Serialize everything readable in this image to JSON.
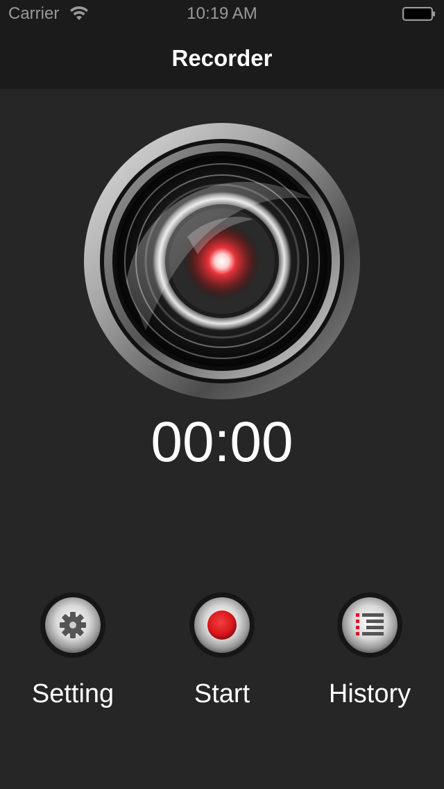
{
  "status_bar": {
    "carrier": "Carrier",
    "time": "10:19 AM"
  },
  "nav": {
    "title": "Recorder"
  },
  "recorder": {
    "timer": "00:00",
    "lens_icon": "camera-lens-icon",
    "indicator_color": "#e8333a"
  },
  "controls": [
    {
      "label": "Setting",
      "icon": "gear-icon"
    },
    {
      "label": "Start",
      "icon": "record-icon",
      "color": "#d9161b"
    },
    {
      "label": "History",
      "icon": "list-icon"
    }
  ]
}
